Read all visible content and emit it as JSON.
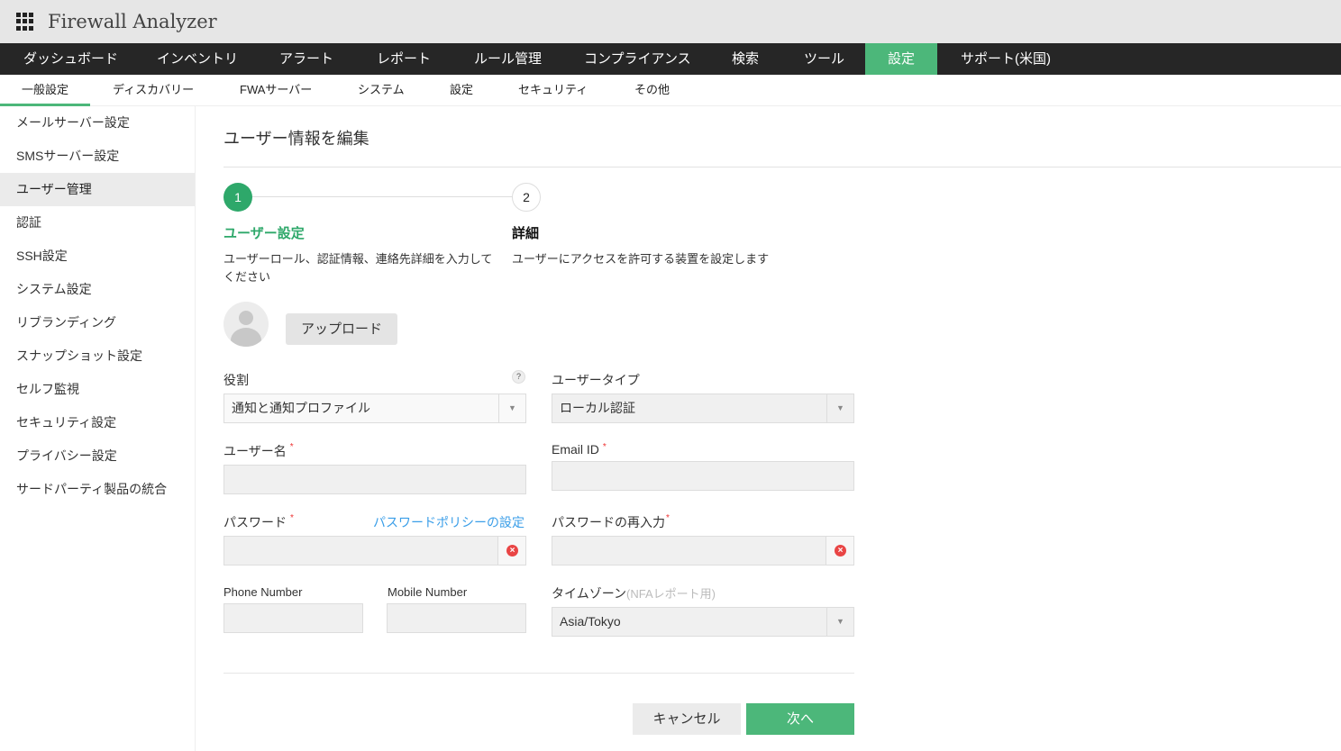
{
  "app": {
    "title": "Firewall Analyzer"
  },
  "nav": [
    "ダッシュボード",
    "インベントリ",
    "アラート",
    "レポート",
    "ルール管理",
    "コンプライアンス",
    "検索",
    "ツール",
    "設定",
    "サポート(米国)"
  ],
  "subnav": [
    "一般設定",
    "ディスカバリー",
    "FWAサーバー",
    "システム",
    "設定",
    "セキュリティ",
    "その他"
  ],
  "sidebar": [
    "メールサーバー設定",
    "SMSサーバー設定",
    "ユーザー管理",
    "認証",
    "SSH設定",
    "システム設定",
    "リブランディング",
    "スナップショット設定",
    "セルフ監視",
    "セキュリティ設定",
    "プライバシー設定",
    "サードパーティ製品の統合"
  ],
  "page": {
    "title": "ユーザー情報を編集"
  },
  "steps": [
    {
      "num": "1",
      "label": "ユーザー設定",
      "desc1": "ユーザーロール、認証情報、連絡先詳細を入力して",
      "desc2": "ください"
    },
    {
      "num": "2",
      "label": "詳細",
      "desc1": "ユーザーにアクセスを許可する装置を設定します"
    }
  ],
  "upload_label": "アップロード",
  "form": {
    "role_label": "役割",
    "role_value": "通知と通知プロファイル",
    "help": "?",
    "usertype_label": "ユーザータイプ",
    "usertype_value": "ローカル認証",
    "username_label": "ユーザー名",
    "email_label": "Email ID",
    "password_label": "パスワード",
    "password_policy_link": "パスワードポリシーの設定",
    "password_confirm_label": "パスワードの再入力",
    "phone_label": "Phone Number",
    "mobile_label": "Mobile Number",
    "timezone_label": "タイムゾーン",
    "timezone_note": "(NFAレポート用)",
    "timezone_value": "Asia/Tokyo",
    "required_mark": "*"
  },
  "buttons": {
    "cancel": "キャンセル",
    "next": "次へ"
  },
  "colors": {
    "accent": "#4cb77a",
    "step_active": "#2ea86a",
    "nav_bg": "#262626",
    "link": "#3a9ee8"
  }
}
